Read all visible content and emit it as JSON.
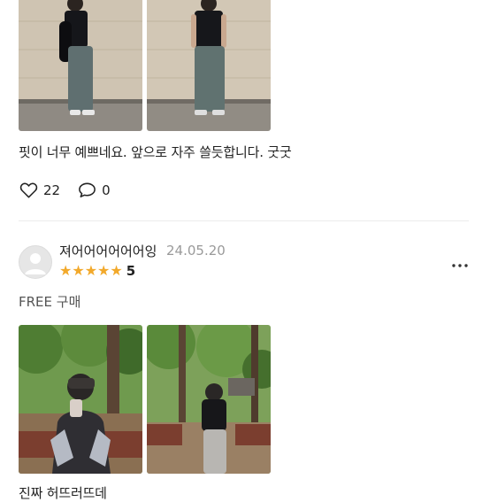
{
  "review1": {
    "text": "핏이 너무 예쁘네요. 앞으로 자주 쓸듯합니다. 굿굿",
    "likes": "22",
    "comments": "0"
  },
  "review2": {
    "username": "져어어어어어어잉",
    "date": "24.05.20",
    "rating": "5",
    "option": "FREE 구매",
    "text": "진짜 허뜨러뜨데"
  },
  "colors": {
    "star": "#f2a92b",
    "date": "#9a9a9a",
    "divider": "#ececec"
  }
}
